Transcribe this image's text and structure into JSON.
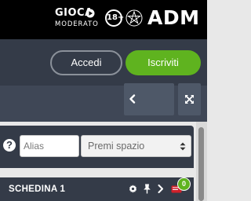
{
  "brand": {
    "gioca": "GIOCA",
    "moderato": "MODERATO",
    "age_limit": "18+",
    "adm": "ADM"
  },
  "auth": {
    "login_label": "Accedi",
    "signup_label": "Iscriviti"
  },
  "search": {
    "alias_placeholder": "Alias",
    "prize_select_value": "Premi spazio"
  },
  "betslip": {
    "title": "SCHEDINA 1",
    "count": "0"
  },
  "colors": {
    "topbar": "#000000",
    "header": "#343b48",
    "toolbar": "#3f4756",
    "accent_green": "#5fb31f",
    "badge_red": "#d0202a"
  },
  "icons": [
    "play-icon",
    "italian-emblem-icon",
    "chevron-left-icon",
    "expand-icon",
    "help-icon",
    "select-arrows-icon",
    "gear-icon",
    "pin-icon",
    "chevron-right-icon",
    "ticket-icon"
  ]
}
